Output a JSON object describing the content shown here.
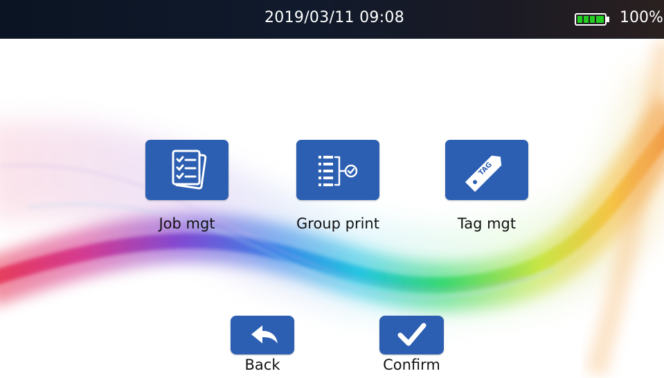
{
  "status_bar": {
    "datetime": "2019/03/11 09:08",
    "battery_percent_label": "100%",
    "battery_level": 1.0,
    "battery_color": "#22cc22",
    "battery_icon": "battery-full-icon"
  },
  "menu": {
    "items": [
      {
        "label": "Job mgt",
        "icon": "job-list-icon"
      },
      {
        "label": "Group print",
        "icon": "group-print-icon"
      },
      {
        "label": "Tag mgt",
        "icon": "tag-icon"
      }
    ]
  },
  "nav": {
    "back_label": "Back",
    "back_icon": "back-arrow-icon",
    "confirm_label": "Confirm",
    "confirm_icon": "checkmark-icon"
  },
  "theme": {
    "accent": "#2c5fb2",
    "status_bar_bg": "#0f1826"
  }
}
